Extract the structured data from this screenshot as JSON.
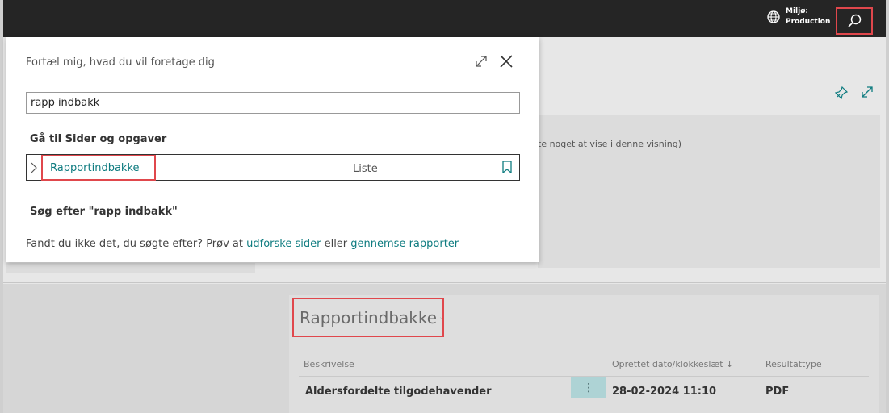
{
  "topbar": {
    "environment_label": "Miljø:",
    "environment_value": "Production",
    "icons": [
      "globe-icon",
      "search-icon"
    ]
  },
  "background": {
    "empty_message": "te noget at vise i denne visning)",
    "panel": {
      "title": "Rapportindbakke",
      "columns": [
        "Beskrivelse",
        "Oprettet dato/klokkeslæt ↓",
        "Resultattype"
      ],
      "rows": [
        {
          "description": "Aldersfordelte tilgodehavender",
          "created": "28-02-2024 11:10",
          "type": "PDF"
        }
      ]
    }
  },
  "dialog": {
    "title": "Fortæl mig, hvad du vil foretage dig",
    "search_value": "rapp indbakk",
    "section_heading": "Gå til Sider og opgaver",
    "result": {
      "label": "Rapportindbakke",
      "type": "Liste"
    },
    "search_for": "Søg efter \"rapp indbakk\"",
    "footer": {
      "prefix": "Fandt du ikke det, du søgte efter? Prøv at ",
      "link1": "udforske sider",
      "middle": " eller ",
      "link2": "gennemse rapporter"
    }
  },
  "colors": {
    "accent": "#0f7c80",
    "highlight": "#e0474c",
    "topbar": "#252525"
  }
}
